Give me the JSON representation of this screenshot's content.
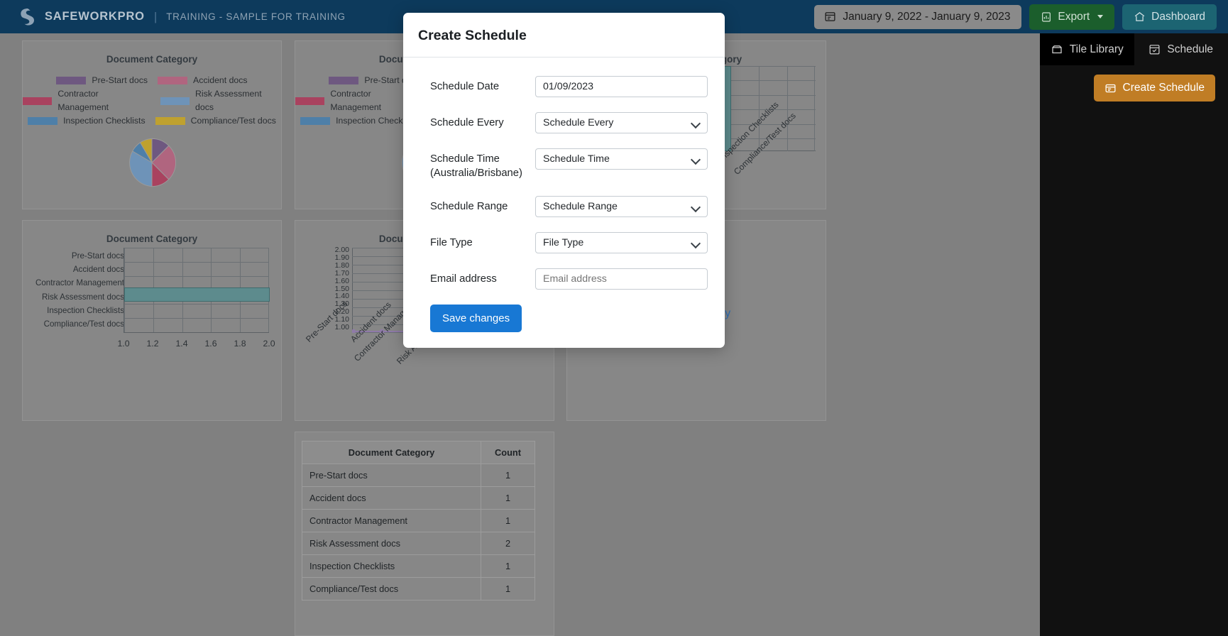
{
  "topbar": {
    "brand_name": "SAFEWORKPRO",
    "separator": "|",
    "subtitle": "TRAINING - SAMPLE FOR TRAINING",
    "date_range": "January 9, 2022 - January 9, 2023",
    "export_label": "Export",
    "dashboard_label": "Dashboard",
    "icons": {
      "logo": "safeworkpro-logo-icon",
      "date": "calendar-range-icon",
      "export": "chart-document-icon",
      "dashboard": "home-icon"
    }
  },
  "right_panel": {
    "tabs": [
      {
        "label": "Tile Library",
        "icon": "archive-box-icon",
        "active": true
      },
      {
        "label": "Schedule",
        "icon": "calendar-check-icon",
        "active": false
      }
    ],
    "create_schedule_label": "Create Schedule",
    "create_schedule_icon": "schedule-card-icon"
  },
  "modal": {
    "title": "Create Schedule",
    "fields": [
      {
        "label": "Schedule Date",
        "type": "text",
        "value": "01/09/2023",
        "placeholder": ""
      },
      {
        "label": "Schedule Every",
        "type": "select",
        "value": "Schedule Every",
        "placeholder": ""
      },
      {
        "label": "Schedule Time (Australia/Brisbane)",
        "type": "select",
        "value": "Schedule Time",
        "placeholder": ""
      },
      {
        "label": "Schedule Range",
        "type": "select",
        "value": "Schedule Range",
        "placeholder": ""
      },
      {
        "label": "File Type",
        "type": "select",
        "value": "File Type",
        "placeholder": ""
      },
      {
        "label": "Email address",
        "type": "email",
        "value": "",
        "placeholder": "Email address"
      }
    ],
    "save_label": "Save changes"
  },
  "palette": {
    "nav_blue": "#0d3a5c",
    "export_green": "#1b5e2c",
    "dashboard_teal": "#1c6472",
    "create_orange": "#c07d25",
    "save_blue": "#1878d4",
    "bar_teal": "#5d8b8d",
    "line_purple": "#8f7aa8"
  },
  "chart_data": [
    {
      "type": "pie",
      "title": "Document Category",
      "categories": [
        "Pre-Start docs",
        "Accident docs",
        "Contractor Management",
        "Risk Assessment docs",
        "Inspection Checklists",
        "Compliance/Test docs"
      ],
      "values": [
        1,
        1,
        1,
        2,
        1,
        1
      ],
      "colors": [
        "#6e5880",
        "#b0657f",
        "#a9425f",
        "#6e93b8",
        "#4e7fa8",
        "#bfa12f"
      ],
      "legend": "top",
      "card": "card-1"
    },
    {
      "type": "pie",
      "title": "Document Category",
      "categories": [
        "Pre-Start docs",
        "Accident docs",
        "Contractor Management",
        "Risk Assessment docs",
        "Inspection Checklists",
        "Compliance/Test docs"
      ],
      "values": [
        1,
        1,
        1,
        2,
        1,
        1
      ],
      "colors": [
        "#6e5880",
        "#b0657f",
        "#a9425f",
        "#6e93b8",
        "#4e7fa8",
        "#bfa12f"
      ],
      "legend": "top",
      "card": "card-2"
    },
    {
      "type": "bar",
      "orientation": "vertical",
      "title": "Document Category",
      "categories": [
        "Pre-Start docs",
        "Accident docs",
        "Contractor Management",
        "Risk Assessment docs",
        "Inspection Checklists",
        "Compliance/Test docs"
      ],
      "values": [
        1,
        1,
        1,
        2,
        1,
        1
      ],
      "ylim": [
        1.0,
        2.0
      ],
      "grid": true,
      "card": "card-3"
    },
    {
      "type": "bar",
      "orientation": "horizontal",
      "title": "Document Category",
      "categories": [
        "Pre-Start docs",
        "Accident docs",
        "Contractor Management",
        "Risk Assessment docs",
        "Inspection Checklists",
        "Compliance/Test docs"
      ],
      "values": [
        1,
        1,
        1,
        2,
        1,
        1
      ],
      "xticks": [
        "1.0",
        "1.2",
        "1.4",
        "1.6",
        "1.8",
        "2.0"
      ],
      "xlim": [
        1.0,
        2.0
      ],
      "grid": true,
      "card": "card-4"
    },
    {
      "type": "line",
      "title": "Document Category",
      "categories": [
        "Pre-Start docs",
        "Accident docs",
        "Contractor Management",
        "Risk Assessment docs",
        "Inspection Checklists",
        "Compliance/Test docs"
      ],
      "values": [
        1,
        1,
        1,
        2,
        1,
        1
      ],
      "yticks": [
        "2.00",
        "1.90",
        "1.80",
        "1.70",
        "1.60",
        "1.50",
        "1.40",
        "1.30",
        "1.20",
        "1.10",
        "1.00"
      ],
      "ylim": [
        1.0,
        2.0
      ],
      "grid": true,
      "card": "card-5"
    },
    {
      "type": "table",
      "title": "",
      "columns": [
        "Document Category",
        "Count"
      ],
      "rows": [
        [
          "Pre-Start docs",
          "1"
        ],
        [
          "Accident docs",
          "1"
        ],
        [
          "Contractor Management",
          "1"
        ],
        [
          "Risk Assessment docs",
          "2"
        ],
        [
          "Inspection Checklists",
          "1"
        ],
        [
          "Compliance/Test docs",
          "1"
        ]
      ],
      "card": "card-6"
    }
  ],
  "card6_partial_link": "ory"
}
